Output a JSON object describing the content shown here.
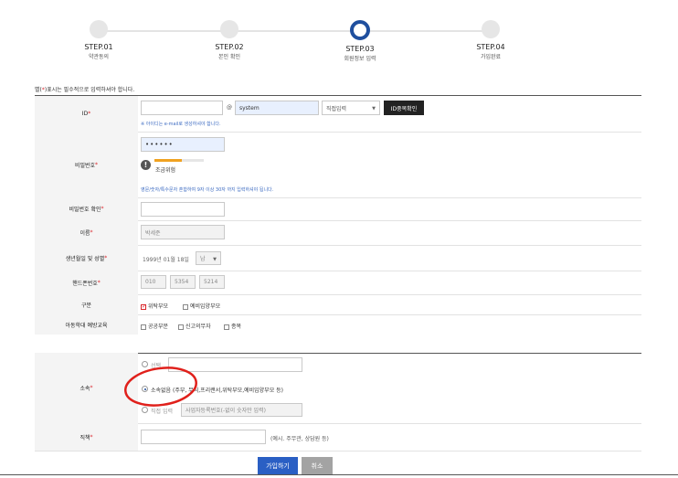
{
  "steps": [
    {
      "num": "STEP.01",
      "label": "약관동의",
      "active": false
    },
    {
      "num": "STEP.02",
      "label": "본인 확인",
      "active": false
    },
    {
      "num": "STEP.03",
      "label": "회원정보 입력",
      "active": true
    },
    {
      "num": "STEP.04",
      "label": "가입완료",
      "active": false
    }
  ],
  "notice": {
    "prefix": "별(",
    "star": "*",
    "suffix": ")표시는 필수적으로 입력하셔야 합니다."
  },
  "rows": {
    "id": {
      "label": "ID",
      "at": "@",
      "domain": "system",
      "domain_select": "직접입력",
      "check_button": "ID중복확인",
      "hint": "※ 아이디는 e-mail로 생성하셔야 합니다."
    },
    "password": {
      "label": "비밀번호",
      "value": "••••••",
      "strength": "조금위험",
      "strength_level": 0.55,
      "hint": "영문/숫자/특수문자 혼합하여 9자 이상 30자 까지 입력하셔야 됩니다."
    },
    "password_confirm": {
      "label": "비밀번호 확인"
    },
    "name": {
      "label": "이름",
      "value": "박세준"
    },
    "birth": {
      "label": "생년월일 및 성별",
      "value": "1999년 01월 18일",
      "gender": "남"
    },
    "phone": {
      "label": "핸드폰번호",
      "p1": "010",
      "p2": "5354",
      "p3": "5214"
    },
    "category": {
      "label": "구분",
      "opt1": "위탁부모",
      "opt2": "예비입양부모"
    },
    "education": {
      "label": "아동학대 예방교육",
      "opt1": "공공부문",
      "opt2": "신고의무자",
      "opt3": "종복"
    },
    "affiliation": {
      "label": "소속",
      "opt1": "선택",
      "opt2": "소속없음 (주부, 무직,프리랜서,위탁부모,예비입양부모 등)",
      "opt3": "직접 입력",
      "opt3_placeholder": "사업자등록번호(-없이 숫자만 입력)"
    },
    "position": {
      "label": "직책",
      "hint": "(예시. 주무관, 상담원 등)"
    }
  },
  "buttons": {
    "submit": "가입하기",
    "cancel": "취소"
  },
  "colors": {
    "accent": "#2a5fc4",
    "required": "#d9262b",
    "annotation": "#e0201b"
  }
}
